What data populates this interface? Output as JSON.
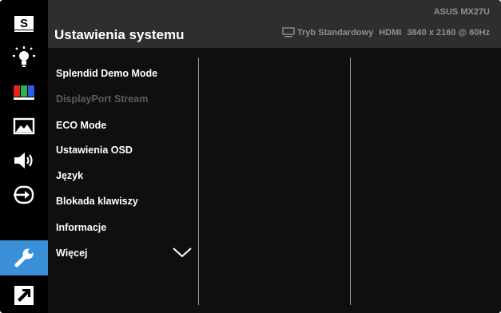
{
  "sidebar": {
    "items": [
      {
        "id": "splendid",
        "icon": "splendid-s-icon",
        "label": "S"
      },
      {
        "id": "bluelight",
        "icon": "blue-light-icon"
      },
      {
        "id": "color",
        "icon": "color-bars-icon"
      },
      {
        "id": "image",
        "icon": "image-icon"
      },
      {
        "id": "sound",
        "icon": "speaker-icon"
      },
      {
        "id": "input",
        "icon": "input-select-icon"
      },
      {
        "id": "system",
        "icon": "wrench-icon",
        "active": true
      },
      {
        "id": "shortcut",
        "icon": "shortcut-arrow-icon"
      }
    ]
  },
  "header": {
    "title": "Ustawienia systemu",
    "model": "ASUS MX27U",
    "mode": "Tryb Standardowy",
    "input": "HDMI",
    "resolution": "3840 x 2160 @ 60Hz"
  },
  "menu": {
    "items": [
      {
        "label": "Splendid Demo Mode",
        "enabled": true
      },
      {
        "label": "DisplayPort Stream",
        "enabled": false
      },
      {
        "label": "ECO Mode",
        "enabled": true
      },
      {
        "label": "Ustawienia OSD",
        "enabled": true
      },
      {
        "label": "Język",
        "enabled": true
      },
      {
        "label": "Blokada klawiszy",
        "enabled": true
      },
      {
        "label": "Informacje",
        "enabled": true
      },
      {
        "label": "Więcej",
        "enabled": true
      }
    ]
  },
  "colors": {
    "background": "#000000",
    "header": "#2e2e2e",
    "accent": "#3a8fd9",
    "text": "#ffffff",
    "muted": "#8f8f8f",
    "disabled": "#5b5b5b"
  }
}
